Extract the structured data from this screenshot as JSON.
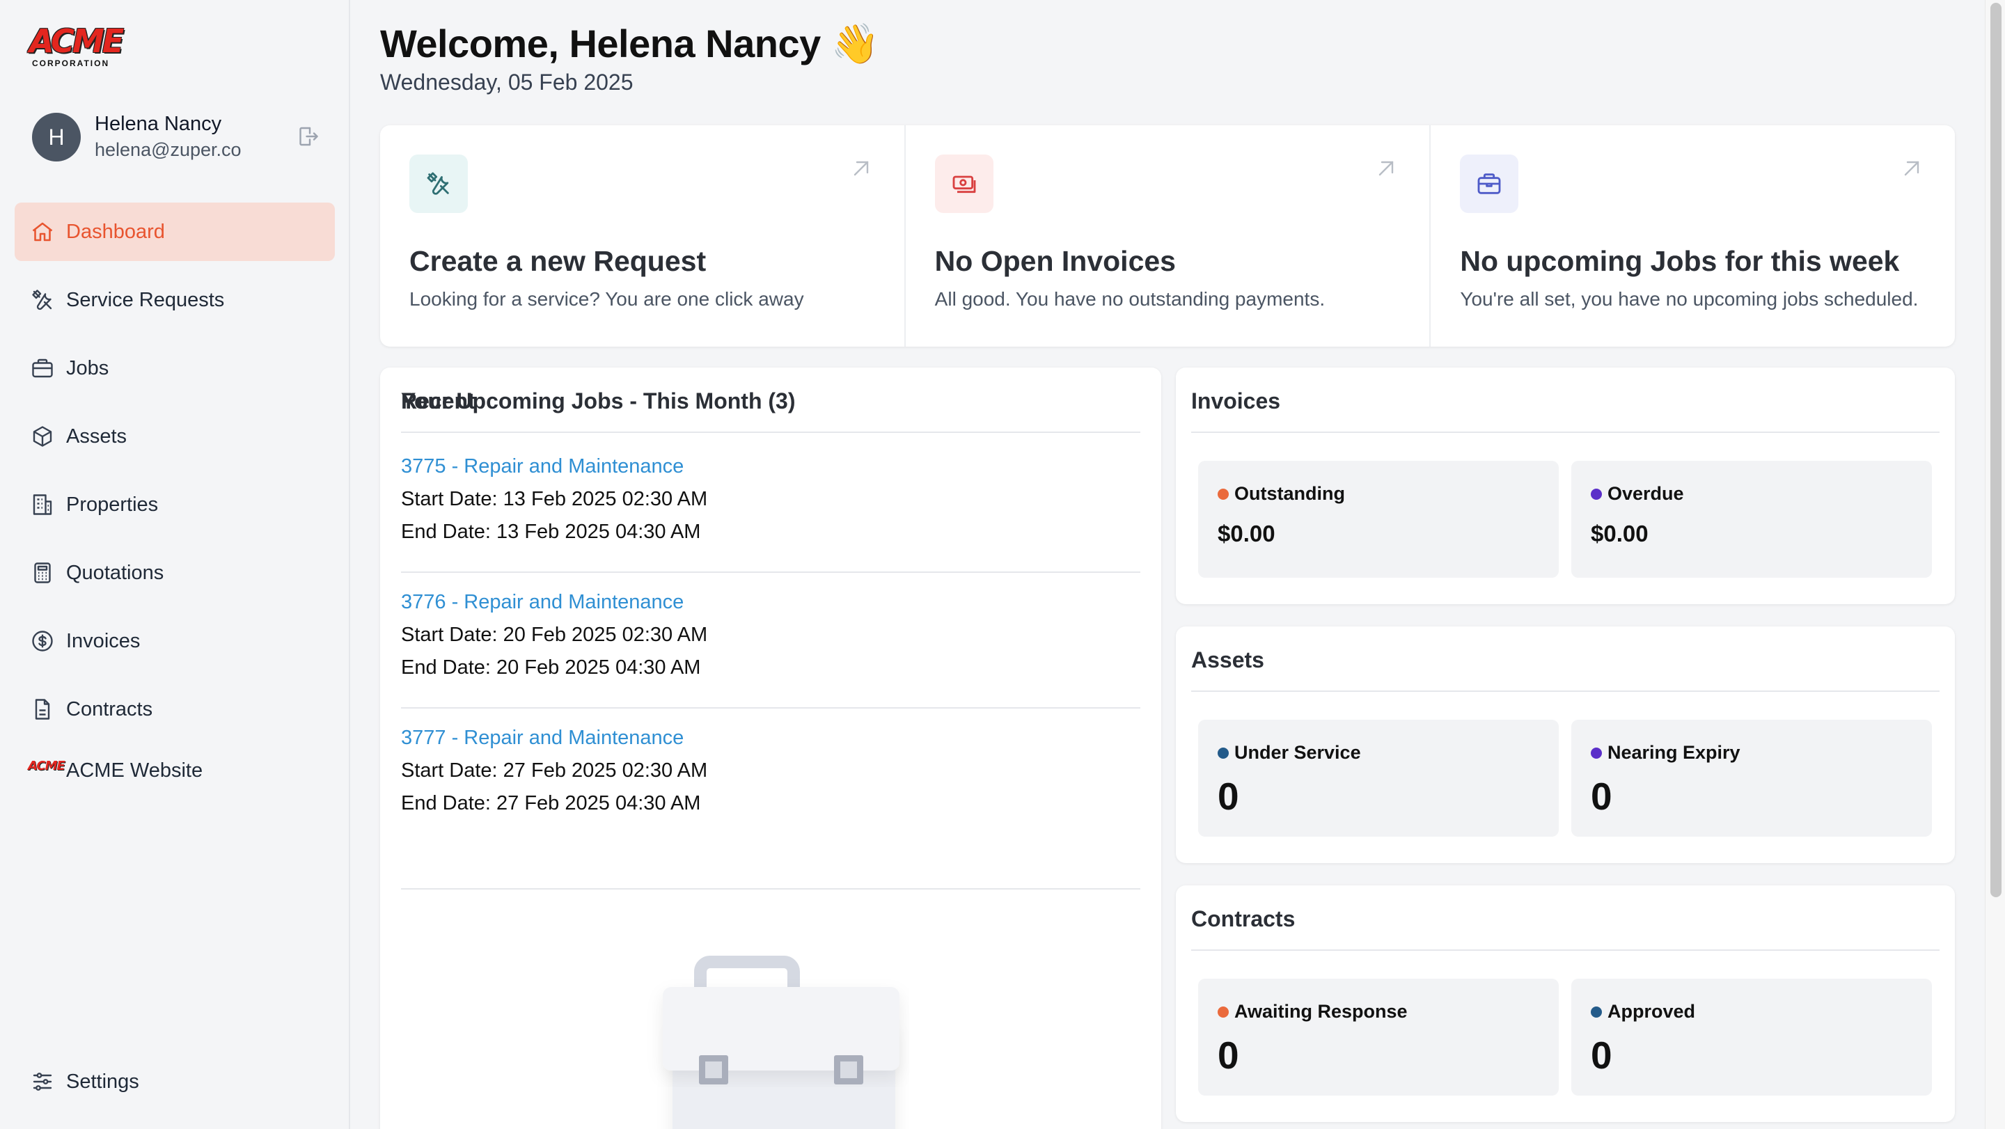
{
  "brand": {
    "logo_text": "ACME",
    "logo_subtext": "CORPORATION",
    "accent_color": "#e8542f"
  },
  "user": {
    "initial": "H",
    "name": "Helena Nancy",
    "email": "helena@zuper.co"
  },
  "nav": {
    "items": [
      {
        "label": "Dashboard",
        "icon": "home-icon",
        "active": true
      },
      {
        "label": "Service Requests",
        "icon": "tools-icon"
      },
      {
        "label": "Jobs",
        "icon": "briefcase-icon"
      },
      {
        "label": "Assets",
        "icon": "cube-icon"
      },
      {
        "label": "Properties",
        "icon": "building-icon"
      },
      {
        "label": "Quotations",
        "icon": "calculator-icon"
      },
      {
        "label": "Invoices",
        "icon": "dollar-circle-icon"
      },
      {
        "label": "Contracts",
        "icon": "document-icon"
      },
      {
        "label": "ACME Website",
        "icon": "acme-logo-icon"
      }
    ],
    "settings_label": "Settings"
  },
  "header": {
    "welcome": "Welcome, Helena Nancy 👋",
    "date": "Wednesday, 05 Feb 2025"
  },
  "quick_actions": [
    {
      "title": "Create a new Request",
      "desc": "Looking for a service? You are one click away",
      "icon": "tools-icon",
      "icon_bg": "#e8f5f5",
      "icon_color": "#2f6f73"
    },
    {
      "title": "No Open Invoices",
      "desc": "All good. You have no outstanding payments.",
      "icon": "money-icon",
      "icon_bg": "#fdeceb",
      "icon_color": "#d94040"
    },
    {
      "title": "No upcoming Jobs for this week",
      "desc": "You're all set, you have no upcoming jobs scheduled.",
      "icon": "briefcase-icon",
      "icon_bg": "#eef0fb",
      "icon_color": "#4e5bc8"
    }
  ],
  "upcoming_jobs": {
    "title": "Your Upcoming Jobs - This Month (3)",
    "jobs": [
      {
        "link": "3775 - Repair and Maintenance",
        "start": "Start Date: 13 Feb 2025 02:30 AM",
        "end": "End Date: 13 Feb 2025 04:30 AM"
      },
      {
        "link": "3776 - Repair and Maintenance",
        "start": "Start Date: 20 Feb 2025 02:30 AM",
        "end": "End Date: 20 Feb 2025 04:30 AM"
      },
      {
        "link": "3777 - Repair and Maintenance",
        "start": "Start Date: 27 Feb 2025 02:30 AM",
        "end": "End Date: 27 Feb 2025 04:30 AM"
      }
    ],
    "recent_title": "Recent"
  },
  "invoices": {
    "title": "Invoices",
    "left": {
      "label": "Outstanding",
      "value": "$0.00",
      "dot": "#ea6a3c"
    },
    "right": {
      "label": "Overdue",
      "value": "$0.00",
      "dot": "#5b2fc9"
    }
  },
  "assets": {
    "title": "Assets",
    "left": {
      "label": "Under Service",
      "value": "0",
      "dot": "#245b8a"
    },
    "right": {
      "label": "Nearing Expiry",
      "value": "0",
      "dot": "#5b2fc9"
    }
  },
  "contracts": {
    "title": "Contracts",
    "left": {
      "label": "Awaiting Response",
      "value": "0",
      "dot": "#ea6a3c"
    },
    "right": {
      "label": "Approved",
      "value": "0",
      "dot": "#245b8a"
    }
  }
}
